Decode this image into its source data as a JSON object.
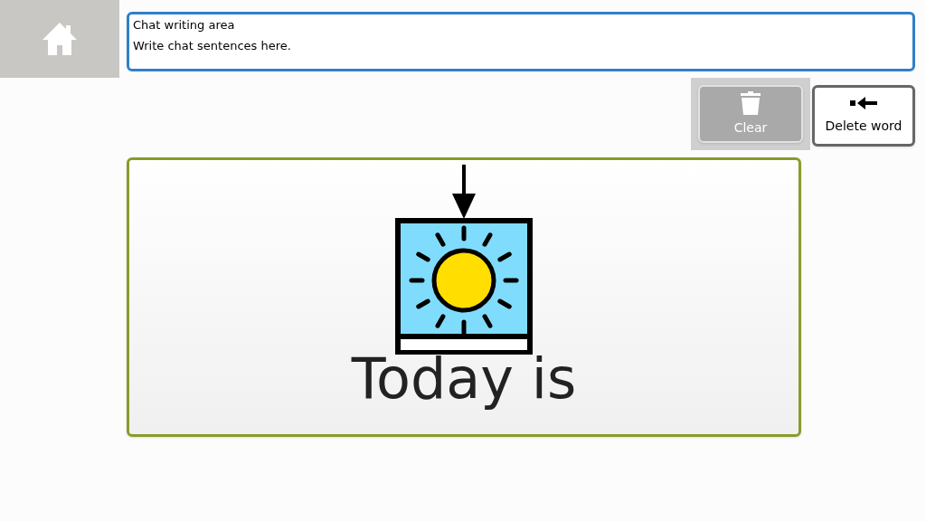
{
  "chat_area": {
    "label": "Chat writing area",
    "placeholder": "Write chat sentences here."
  },
  "buttons": [
    {
      "kind": "clear",
      "label": "Clear",
      "disabled": true
    },
    {
      "kind": "delete_word",
      "label": "Delete word",
      "disabled": false
    }
  ],
  "symbol_card": {
    "label": "Today is"
  }
}
